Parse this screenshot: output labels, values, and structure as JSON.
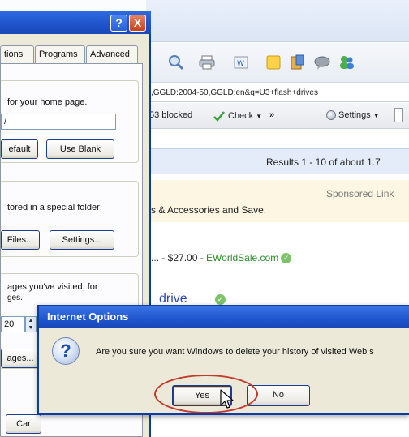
{
  "options_window": {
    "help_button": "?",
    "close_button": "X",
    "tabs": [
      "tions",
      "Programs",
      "Advanced"
    ],
    "home_page_text": "for your home page.",
    "home_page_value": "/",
    "use_default_label": "efault",
    "use_blank_label": "Use Blank",
    "temp_files_text": "tored in a special folder",
    "delete_files_label": "Files...",
    "settings_label": "Settings...",
    "history_text_1": "ages you've visited, for",
    "history_text_2": "ges.",
    "days_value": "20",
    "clear_history_label": "ages...",
    "cancel_label": "Car"
  },
  "browser": {
    "address": ",GGLD:2004-50,GGLD:en&q=U3+flash+drives",
    "toolbar": {
      "blocked": "53 blocked",
      "check": "Check",
      "more": "»",
      "settings": "Settings"
    },
    "results": "Results 1 - 10 of about 1.7",
    "sponsored_label": "Sponsored Link",
    "ad_line_1": "s & Accessories and Save.",
    "ad_line_2_price": "... - $27.00 - ",
    "ad_line_2_site": "EWorldSale.com",
    "drive_text": "drive"
  },
  "dialog": {
    "title": "Internet Options",
    "message": "Are you sure you want Windows to delete your history of visited Web s",
    "yes_label": "Yes",
    "no_label": "No"
  },
  "colors": {
    "title_blue": "#2158d1",
    "highlight_red": "#c23a2a",
    "link_green": "#2e8b2e"
  }
}
